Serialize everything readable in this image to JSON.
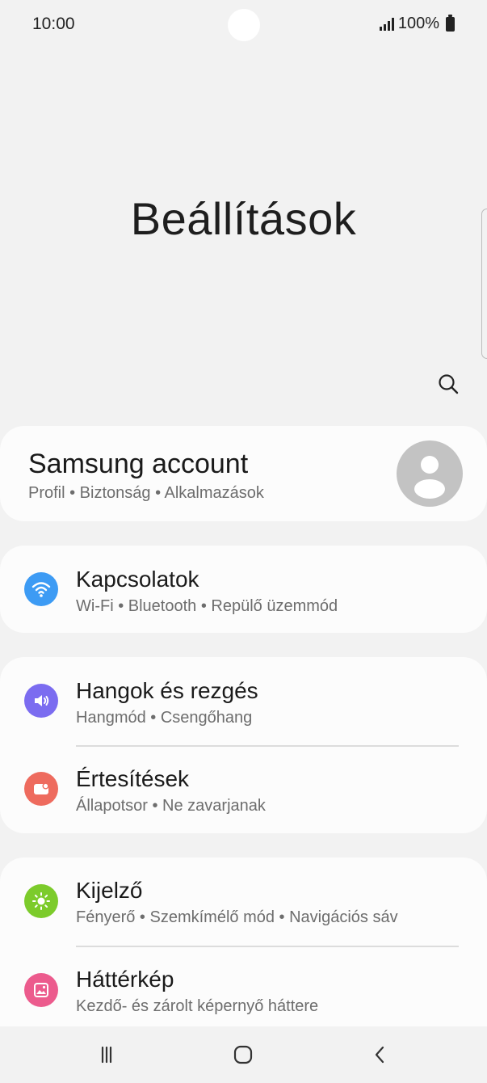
{
  "status_bar": {
    "time": "10:00",
    "battery_text": "100%",
    "icons": [
      "camera-cutout",
      "signal-icon",
      "battery-icon"
    ]
  },
  "header": {
    "title": "Beállítások",
    "search_icon": "search-icon"
  },
  "account": {
    "title": "Samsung account",
    "subtitle": "Profil  •  Biztonság  •  Alkalmazások",
    "avatar_icon": "person-avatar-icon"
  },
  "settings": {
    "connections": {
      "title": "Kapcsolatok",
      "subtitle": "Wi-Fi  •  Bluetooth  •  Repülő üzemmód",
      "icon": "wifi-icon",
      "color": "#3d9bf4"
    },
    "sounds": {
      "title": "Hangok és rezgés",
      "subtitle": "Hangmód  •  Csengőhang",
      "icon": "speaker-icon",
      "color": "#7b6cf0"
    },
    "notifications": {
      "title": "Értesítések",
      "subtitle": "Állapotsor  •  Ne zavarjanak",
      "icon": "notification-icon",
      "color": "#ee6b5e"
    },
    "display": {
      "title": "Kijelző",
      "subtitle": "Fényerő  •  Szemkímélő mód  •  Navigációs sáv",
      "icon": "brightness-icon",
      "color": "#7ccb2b"
    },
    "wallpaper": {
      "title": "Háttérkép",
      "subtitle": "Kezdő- és zárolt képernyő háttere",
      "icon": "wallpaper-icon",
      "color": "#ec5b8d"
    }
  },
  "nav_bar": {
    "buttons": [
      "recent-apps-icon",
      "home-icon",
      "back-icon"
    ]
  }
}
